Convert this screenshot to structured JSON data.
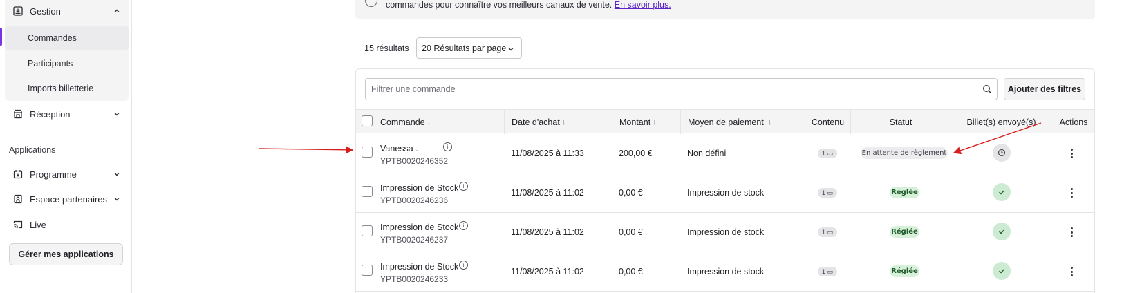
{
  "sidebar": {
    "gestion_label": "Gestion",
    "sub_items": [
      "Commandes",
      "Participants",
      "Imports billetterie"
    ],
    "reception_label": "Réception",
    "applications_label": "Applications",
    "app_items": [
      "Programme",
      "Espace partenaires",
      "Live"
    ],
    "apps_button": "Gérer mes applications"
  },
  "banner": {
    "text": "commandes pour connaître vos meilleurs canaux de vente.",
    "link": "En savoir plus."
  },
  "toolbar": {
    "results": "15 résultats",
    "per_page": "20 Résultats par page",
    "filter_placeholder": "Filtrer une commande",
    "filter_button": "Ajouter des filtres"
  },
  "table": {
    "headers": [
      "Commande",
      "Date d'achat",
      "Montant",
      "Moyen de paiement",
      "Contenu",
      "Statut",
      "Billet(s) envoyé(s)",
      "Actions"
    ],
    "rows": [
      {
        "name": "Vanessa .",
        "ref": "YPTB0020246352",
        "date": "11/08/2025 à 11:33",
        "amount": "200,00 €",
        "payment": "Non défini",
        "count": "1",
        "status": "En attente de règlement",
        "status_kind": "pending",
        "sent": "pending"
      },
      {
        "name": "Impression de Stock",
        "ref": "YPTB0020246236",
        "date": "11/08/2025 à 11:02",
        "amount": "0,00 €",
        "payment": "Impression de stock",
        "count": "1",
        "status": "Réglée",
        "status_kind": "paid",
        "sent": "done"
      },
      {
        "name": "Impression de Stock",
        "ref": "YPTB0020246237",
        "date": "11/08/2025 à 11:02",
        "amount": "0,00 €",
        "payment": "Impression de stock",
        "count": "1",
        "status": "Réglée",
        "status_kind": "paid",
        "sent": "done"
      },
      {
        "name": "Impression de Stock",
        "ref": "YPTB0020246233",
        "date": "11/08/2025 à 11:02",
        "amount": "0,00 €",
        "payment": "Impression de stock",
        "count": "1",
        "status": "Réglée",
        "status_kind": "paid",
        "sent": "done"
      }
    ]
  },
  "colors": {
    "accent": "#7a32e6",
    "annotation": "#d62020"
  }
}
